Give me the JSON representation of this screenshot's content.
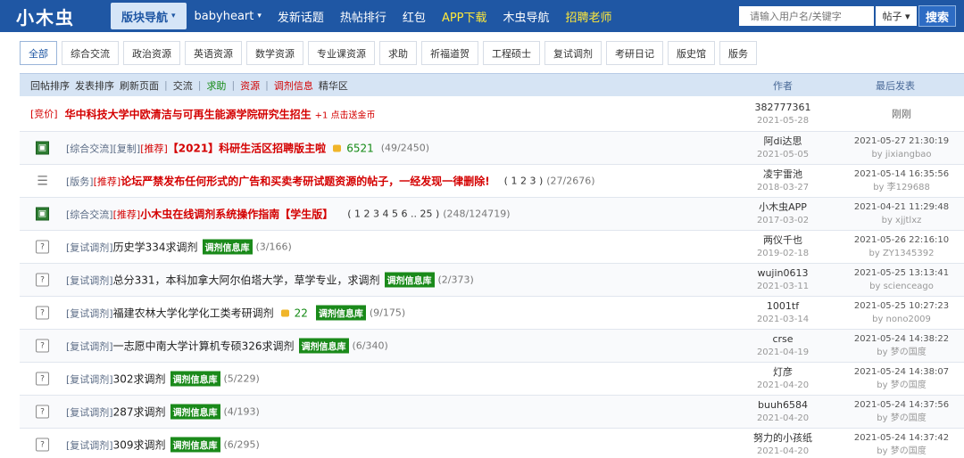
{
  "header": {
    "logo": "小木虫",
    "nav": [
      {
        "label": "版块导航",
        "caret": "▾",
        "active": true
      },
      {
        "label": "babyheart",
        "caret": "▾"
      },
      {
        "label": "发新话题"
      },
      {
        "label": "热帖排行"
      },
      {
        "label": "红包"
      },
      {
        "label": "APP下载",
        "yellow": true
      },
      {
        "label": "木虫导航"
      },
      {
        "label": "招聘老师",
        "yellow": true
      }
    ],
    "search_placeholder": "请输入用户名/关键字",
    "search_select": "帖子 ▾",
    "search_button": "搜索"
  },
  "categories": [
    "全部",
    "综合交流",
    "政治资源",
    "英语资源",
    "数学资源",
    "专业课资源",
    "求助",
    "祈福道贺",
    "工程硕士",
    "复试调剂",
    "考研日记",
    "版史馆",
    "版务"
  ],
  "list_header": {
    "items": [
      "回帖排序",
      "发表排序",
      "刷新页面"
    ],
    "sep": "|",
    "jiaoliu": "交流",
    "qiuzhu": "求助",
    "ziyuan": "资源",
    "tiaoji": "调剂信息",
    "jinghua": "精华区",
    "author": "作者",
    "last": "最后发表"
  },
  "ad_row": {
    "tag": "[竞价]",
    "title": "华中科技大学中欧清洁与可再生能源学院研究生招生",
    "extra": "+1 点击送金币",
    "author": "382777361",
    "author_date": "2021-05-28",
    "last": "刚刚"
  },
  "rows": [
    {
      "icon": "image",
      "tag1": "[综合交流]",
      "tag2": "[复制]",
      "tag3": "[推荐]",
      "title": "【2021】科研生活区招聘版主啦",
      "coin": "6521",
      "count": "(49/2450)",
      "author": "阿di达思",
      "author_date": "2021-05-05",
      "last_time": "2021-05-27 21:30:19",
      "last_by": "by jixiangbao"
    },
    {
      "icon": "doc",
      "tag1": "[版务]",
      "tag2": "[推荐]",
      "title": "论坛严禁发布任何形式的广告和买卖考研试题资源的帖子，一经发现一律删除!",
      "pages": "( 1 2 3 )",
      "count": "(27/2676)",
      "author": "凌宇雷池",
      "author_date": "2018-03-27",
      "last_time": "2021-05-14 16:35:56",
      "last_by": "by 李129688"
    },
    {
      "icon": "image",
      "tag1": "[综合交流]",
      "tag2": "[推荐]",
      "title": "小木虫在线调剂系统操作指南【学生版】",
      "pages": "( 1 2 3 4 5 6 .. 25 )",
      "count": "(248/124719)",
      "author": "小木虫APP",
      "author_date": "2017-03-02",
      "last_time": "2021-04-21 11:29:48",
      "last_by": "by xjjtlxz"
    },
    {
      "icon": "q",
      "tag1": "[复试调剂]",
      "title": "历史学334求调剂",
      "badge": "调剂信息库",
      "count": "(3/166)",
      "author": "两仪千也",
      "author_date": "2019-02-18",
      "last_time": "2021-05-26 22:16:10",
      "last_by": "by ZY1345392"
    },
    {
      "icon": "q",
      "tag1": "[复试调剂]",
      "title": "总分331，本科加拿大阿尔伯塔大学，草学专业，求调剂",
      "badge": "调剂信息库",
      "count": "(2/373)",
      "author": "wujin0613",
      "author_date": "2021-03-11",
      "last_time": "2021-05-25 13:13:41",
      "last_by": "by scienceago"
    },
    {
      "icon": "q",
      "tag1": "[复试调剂]",
      "title": "福建农林大学化学化工类考研调剂",
      "coin": "22",
      "badge": "调剂信息库",
      "count": "(9/175)",
      "author": "1001tf",
      "author_date": "2021-03-14",
      "last_time": "2021-05-25 10:27:23",
      "last_by": "by nono2009"
    },
    {
      "icon": "q",
      "tag1": "[复试调剂]",
      "title": "一志愿中南大学计算机专硕326求调剂",
      "badge": "调剂信息库",
      "count": "(6/340)",
      "author": "crse",
      "author_date": "2021-04-19",
      "last_time": "2021-05-24 14:38:22",
      "last_by": "by 梦の国度"
    },
    {
      "icon": "q",
      "tag1": "[复试调剂]",
      "title": "302求调剂",
      "badge": "调剂信息库",
      "count": "(5/229)",
      "author": "灯彦",
      "author_date": "2021-04-20",
      "last_time": "2021-05-24 14:38:07",
      "last_by": "by 梦の国度"
    },
    {
      "icon": "q",
      "tag1": "[复试调剂]",
      "title": "287求调剂",
      "badge": "调剂信息库",
      "count": "(4/193)",
      "author": "buuh6584",
      "author_date": "2021-04-20",
      "last_time": "2021-05-24 14:37:56",
      "last_by": "by 梦の国度"
    },
    {
      "icon": "q",
      "tag1": "[复试调剂]",
      "title": "309求调剂",
      "badge": "调剂信息库",
      "count": "(6/295)",
      "author": "努力的小孩纸",
      "author_date": "2021-04-20",
      "last_time": "2021-05-24 14:37:42",
      "last_by": "by 梦の国度"
    }
  ]
}
